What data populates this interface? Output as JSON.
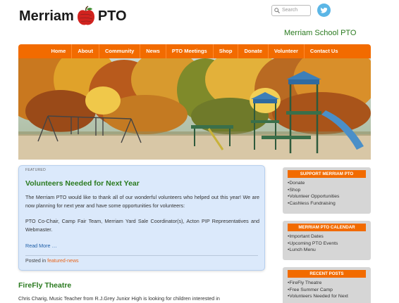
{
  "header": {
    "logo_left": "Merriam",
    "logo_right": "PTO",
    "search_placeholder": "Search",
    "site_title": "Merriam School PTO"
  },
  "nav": {
    "items": [
      "Home",
      "About",
      "Community",
      "News",
      "PTO Meetings",
      "Shop",
      "Donate",
      "Volunteer",
      "Contact Us"
    ]
  },
  "featured_post": {
    "tag": "FEATURED",
    "title": "Volunteers Needed for Next Year",
    "paragraph1": "The Merriam PTO would like to thank all of our wonderful volunteers who helped out this year! We are now planning for next year and have some opportunities for volunteers:",
    "paragraph2": "PTO Co-Chair, Camp Fair Team, Merriam Yard Sale Coordinator(s), Acton PIP Representatives and Webmaster.",
    "read_more": "Read More …",
    "posted_prefix": "Posted in",
    "category": "featured-news"
  },
  "second_post": {
    "title": "FireFly Theatre",
    "excerpt": "Chris Charig, Music Teacher from R.J.Grey Junior High is looking for children interested in"
  },
  "sidebar": {
    "support": {
      "title": "SUPPORT MERRIAM PTO",
      "items": [
        "Donate",
        "Shop",
        "Volunteer Opportunities",
        "Cashless Fundraising"
      ]
    },
    "calendar": {
      "title": "MERRIAM PTO CALENDAR",
      "items": [
        "Important Dates",
        "Upcoming PTO Events",
        "Lunch Menu"
      ]
    },
    "recent": {
      "title": "RECENT POSTS",
      "items": [
        "FireFly Theatre",
        "Free Summer Camp",
        "Volunteers Needed for Next"
      ]
    }
  },
  "colors": {
    "nav_orange": "#f26b00",
    "title_green": "#2a7a1f",
    "featured_bg": "#dbe9fb",
    "link_blue": "#1f5fa8"
  }
}
